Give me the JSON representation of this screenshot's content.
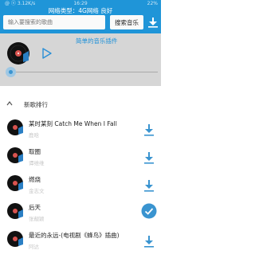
{
  "status_bar": {
    "left": "@ ⓝ 3.12K/s",
    "time": "16:29",
    "right": "22%"
  },
  "header": {
    "network_title": "网络类型：4G网络 良好",
    "search_placeholder": "输入要搜索的歌曲",
    "search_button": "搜索音乐",
    "download_icon": "download-icon"
  },
  "player": {
    "plugin_label": "简单的音乐插件",
    "progress": 0.0
  },
  "section": {
    "title": "新歌排行"
  },
  "songs": [
    {
      "title": "某时某刻 Catch Me When I Fall",
      "artist": "鹿晗",
      "downloaded": false
    },
    {
      "title": "取圈",
      "artist": "谭维维",
      "downloaded": false
    },
    {
      "title": "燃烧",
      "artist": "金志文",
      "downloaded": false
    },
    {
      "title": "后天",
      "artist": "张靓颖",
      "downloaded": true
    },
    {
      "title": "最近的永远-(电视剧《蜂鸟》插曲)",
      "artist": "阿达",
      "downloaded": false
    }
  ],
  "colors": {
    "accent": "#1f95d8",
    "player_bg": "#d6d6d6",
    "check": "#3a94d0"
  }
}
